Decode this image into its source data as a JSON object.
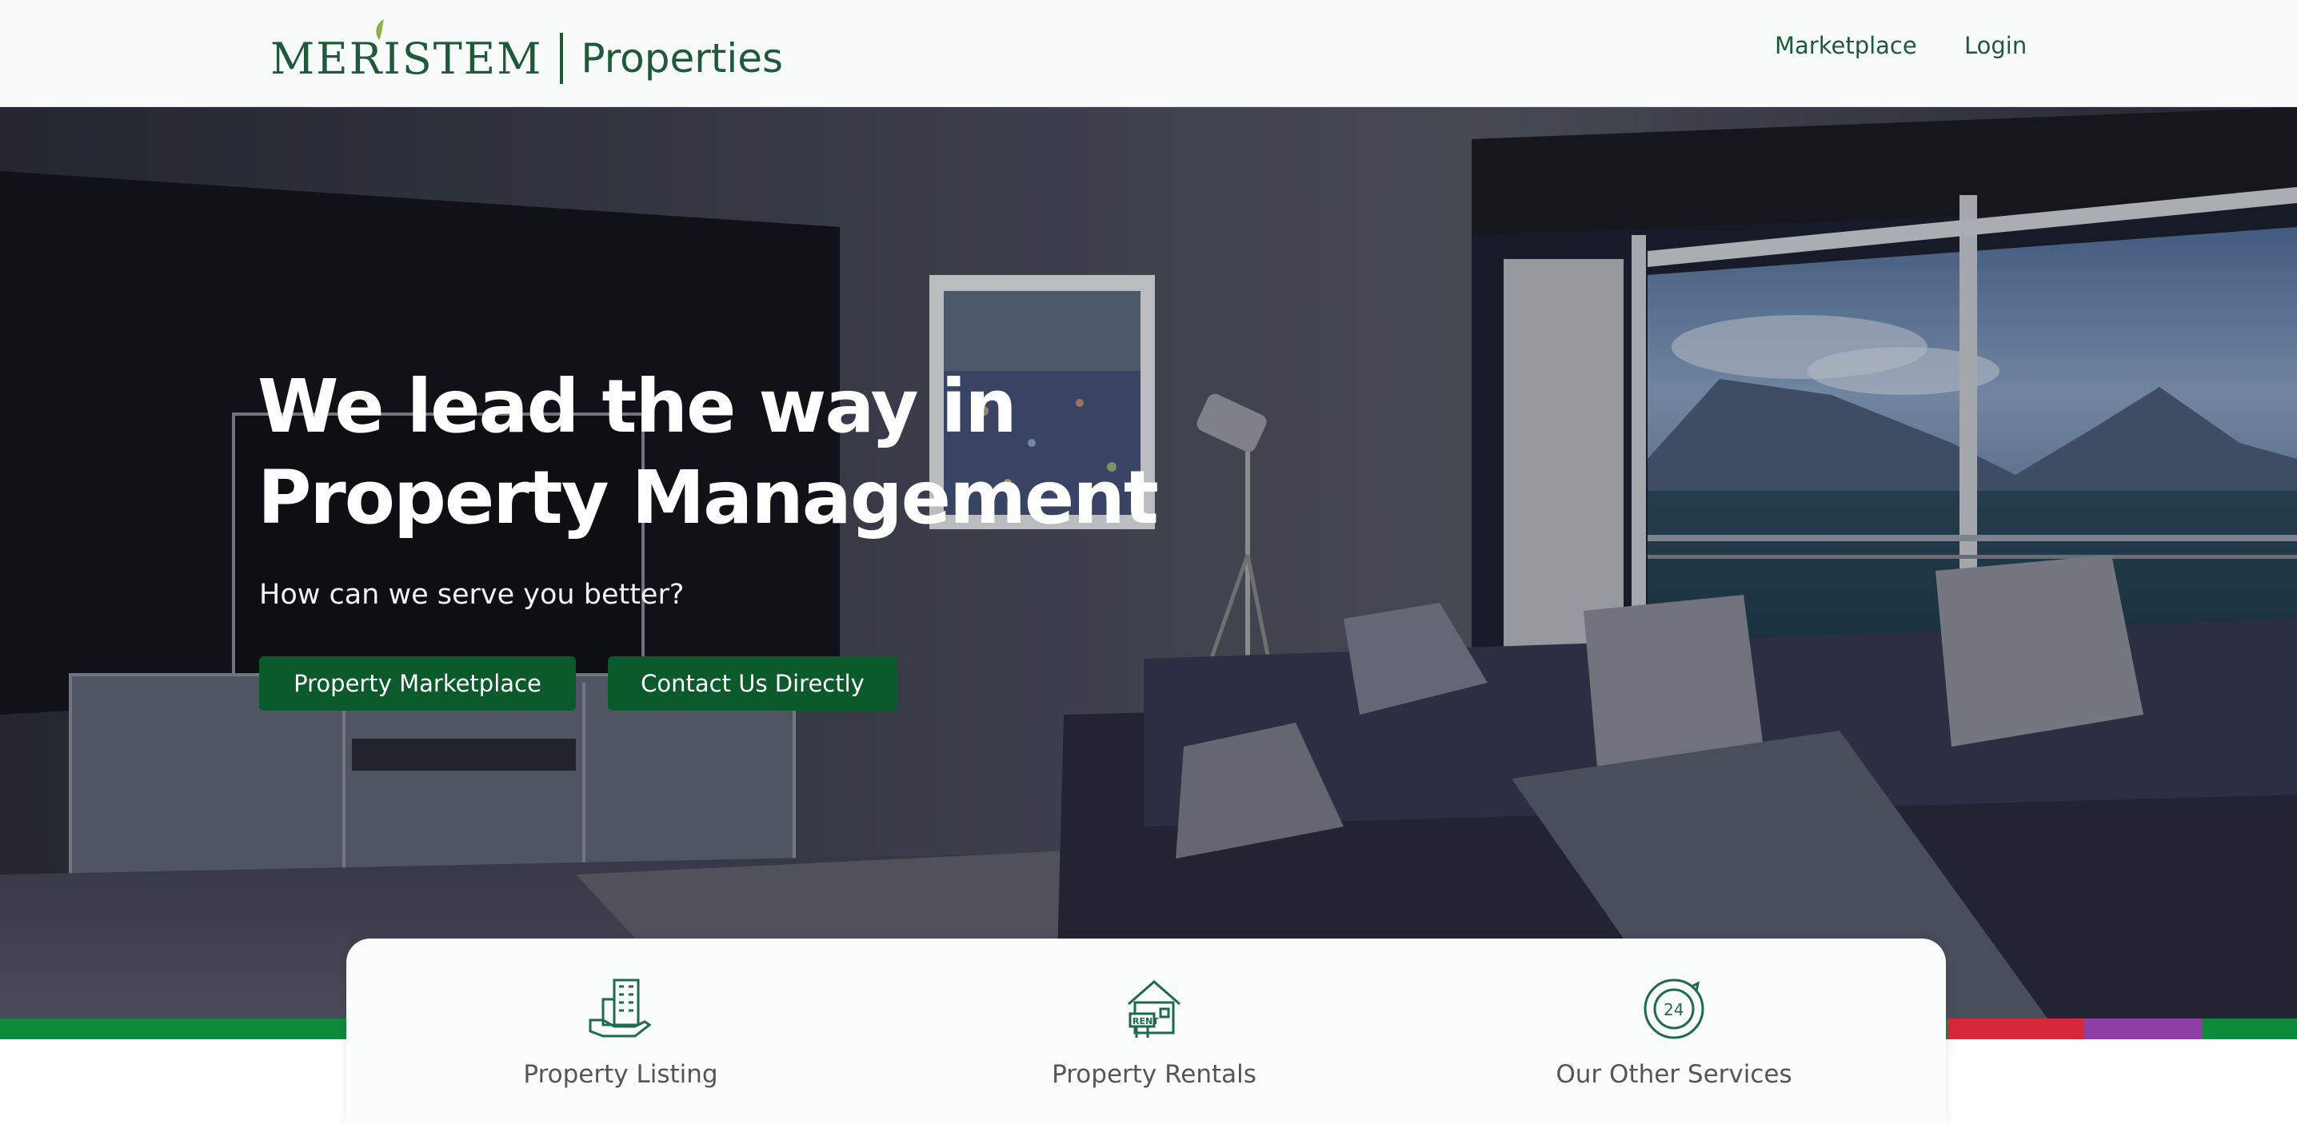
{
  "brand": {
    "name": "MERISTEM",
    "suffix": "Properties"
  },
  "nav": {
    "items": [
      {
        "label": "Marketplace"
      },
      {
        "label": "Login"
      }
    ]
  },
  "hero": {
    "title_line1": "We lead the way in",
    "title_line2": "Property Management",
    "subtitle": "How can we serve you better?",
    "buttons": [
      {
        "label": "Property Marketplace"
      },
      {
        "label": "Contact Us Directly"
      }
    ]
  },
  "services": [
    {
      "label": "Property Listing",
      "icon": "building-hand-icon"
    },
    {
      "label": "Property Rentals",
      "icon": "rent-house-icon"
    },
    {
      "label": "Our Other Services",
      "icon": "24-hours-clock-icon"
    }
  ],
  "colors": {
    "brand_green": "#1e5a3a",
    "button_green": "#0b5a2b",
    "stripe_green": "#0f8a3a",
    "stripe_red": "#d62839",
    "stripe_purple": "#8e3fa5"
  }
}
